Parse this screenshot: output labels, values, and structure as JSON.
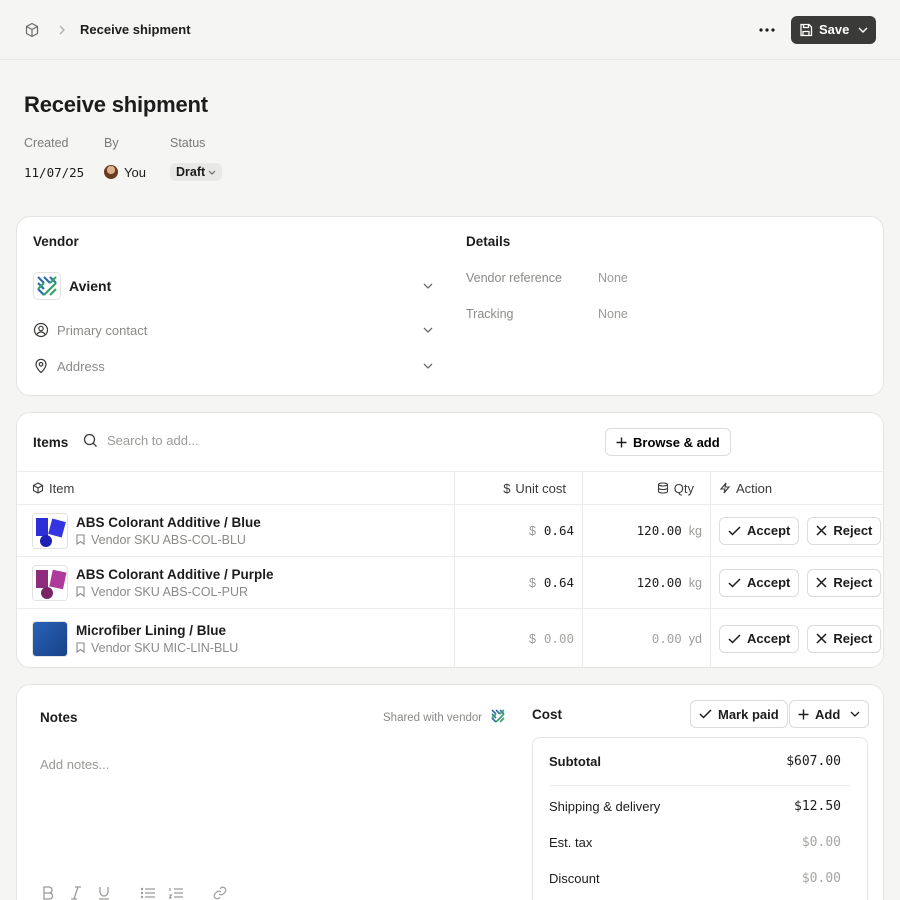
{
  "breadcrumb": {
    "current": "Receive shipment"
  },
  "toolbar": {
    "save_label": "Save"
  },
  "page": {
    "title": "Receive shipment"
  },
  "meta": {
    "created_label": "Created",
    "created_value": "11/07/25",
    "by_label": "By",
    "by_value": "You",
    "status_label": "Status",
    "status_value": "Draft"
  },
  "vendor": {
    "title": "Vendor",
    "name": "Avient",
    "primary_contact_placeholder": "Primary contact",
    "address_placeholder": "Address"
  },
  "details": {
    "title": "Details",
    "rows": [
      {
        "key": "Vendor reference",
        "value": "None"
      },
      {
        "key": "Tracking",
        "value": "None"
      }
    ]
  },
  "items": {
    "title": "Items",
    "search_placeholder": "Search to add...",
    "browse_label": "Browse & add",
    "columns": {
      "item": "Item",
      "unit_cost": "Unit cost",
      "qty": "Qty",
      "action": "Action"
    },
    "accept_label": "Accept",
    "reject_label": "Reject",
    "currency": "$",
    "rows": [
      {
        "name": "ABS Colorant Additive / Blue",
        "sku": "Vendor SKU ABS-COL-BLU",
        "unit_cost": "0.64",
        "qty": "120.00",
        "unit": "kg",
        "thumb_color": "#2d2ed8"
      },
      {
        "name": "ABS Colorant Additive / Purple",
        "sku": "Vendor SKU ABS-COL-PUR",
        "unit_cost": "0.64",
        "qty": "120.00",
        "unit": "kg",
        "thumb_color": "#a2358f"
      },
      {
        "name": "Microfiber Lining / Blue",
        "sku": "Vendor SKU MIC-LIN-BLU",
        "unit_cost": "0.00",
        "qty": "0.00",
        "unit": "yd",
        "thumb_color": "#1e4f9c"
      }
    ]
  },
  "notes": {
    "title": "Notes",
    "shared_label": "Shared with vendor",
    "placeholder": "Add notes..."
  },
  "cost": {
    "title": "Cost",
    "mark_paid_label": "Mark paid",
    "add_label": "Add",
    "subtotal_label": "Subtotal",
    "subtotal_value": "$607.00",
    "shipping_label": "Shipping & delivery",
    "shipping_value": "$12.50",
    "tax_label": "Est. tax",
    "tax_value": "$0.00",
    "discount_label": "Discount",
    "discount_value": "$0.00"
  },
  "colors": {
    "save_button": "#3a3a38",
    "page_bg": "#f5f5f4",
    "vendor_logo_blue": "#2b6cb0",
    "vendor_logo_green": "#38a169"
  }
}
